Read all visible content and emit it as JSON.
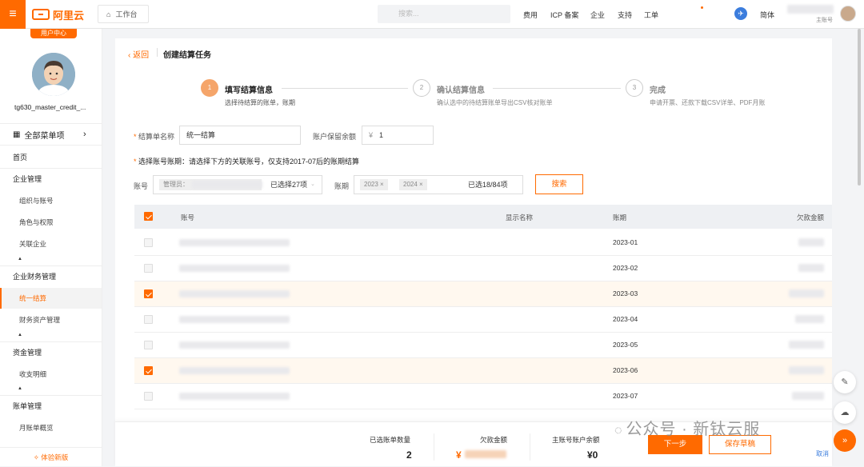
{
  "topbar": {
    "brand": "阿里云",
    "workspace_tab": "工作台",
    "search_placeholder": "搜索...",
    "nav": [
      "费用",
      "ICP 备案",
      "企业",
      "支持",
      "工单"
    ],
    "lang": "简体",
    "account_type": "主账号"
  },
  "sidebar": {
    "badge": "用户中心",
    "username": "tg630_master_credit_...",
    "all_menu": "全部菜单项",
    "items": [
      {
        "label": "首页",
        "level": "h"
      },
      {
        "label": "企业管理",
        "level": "h"
      },
      {
        "label": "组织与账号",
        "level": "s"
      },
      {
        "label": "角色与权限",
        "level": "s"
      },
      {
        "label": "关联企业",
        "level": "s"
      },
      {
        "label": "企业财务管理",
        "level": "h"
      },
      {
        "label": "统一结算",
        "level": "s",
        "active": true
      },
      {
        "label": "财务资产管理",
        "level": "s"
      },
      {
        "label": "资金管理",
        "level": "h"
      },
      {
        "label": "收支明细",
        "level": "s"
      },
      {
        "label": "账单管理",
        "level": "h"
      },
      {
        "label": "月账单概览",
        "level": "s"
      }
    ],
    "trial": "体验新版"
  },
  "page": {
    "back": "返回",
    "title": "创建结算任务"
  },
  "steps": [
    {
      "num": "1",
      "title": "填写结算信息",
      "desc": "选择待结算的账单，账期",
      "active": true
    },
    {
      "num": "2",
      "title": "确认结算信息",
      "desc": "确认选中的待结算账单导出CSV核对账单"
    },
    {
      "num": "3",
      "title": "完成",
      "desc": "申请开票、还款下载CSV详单、PDF月账"
    }
  ],
  "form": {
    "name_label": "结算单名称",
    "name_value": "统一结算",
    "balance_label": "账户保留余额",
    "currency": "¥",
    "balance_value": "1",
    "notice": "选择账号账期：请选择下方的关联账号，仅支持2017-07后的账期结算",
    "account_label": "账号",
    "account_chip": "管理员：",
    "account_selected": "已选择27项",
    "period_label": "账期",
    "period_chips": [
      "2023",
      "2024"
    ],
    "period_selected": "已选18/84项",
    "search_btn": "搜索"
  },
  "table": {
    "headers": [
      "账号",
      "显示名称",
      "账期",
      "欠款金额"
    ],
    "rows": [
      {
        "period": "2023-01",
        "selected": false
      },
      {
        "period": "2023-02",
        "selected": false
      },
      {
        "period": "2023-03",
        "selected": true
      },
      {
        "period": "2023-04",
        "selected": false
      },
      {
        "period": "2023-05",
        "selected": false
      },
      {
        "period": "2023-06",
        "selected": true
      },
      {
        "period": "2023-07",
        "selected": false
      }
    ]
  },
  "footer": {
    "count_label": "已选账单数量",
    "count_value": "2",
    "debt_label": "欠款金额",
    "debt_currency": "¥",
    "balance_label": "主账号账户余额",
    "balance_value": "¥0",
    "next_btn": "下一步",
    "save_btn": "保存草稿",
    "cancel": "取消"
  },
  "watermark": "公众号 · 新钛云服",
  "colors": {
    "accent": "#ff6a00"
  }
}
